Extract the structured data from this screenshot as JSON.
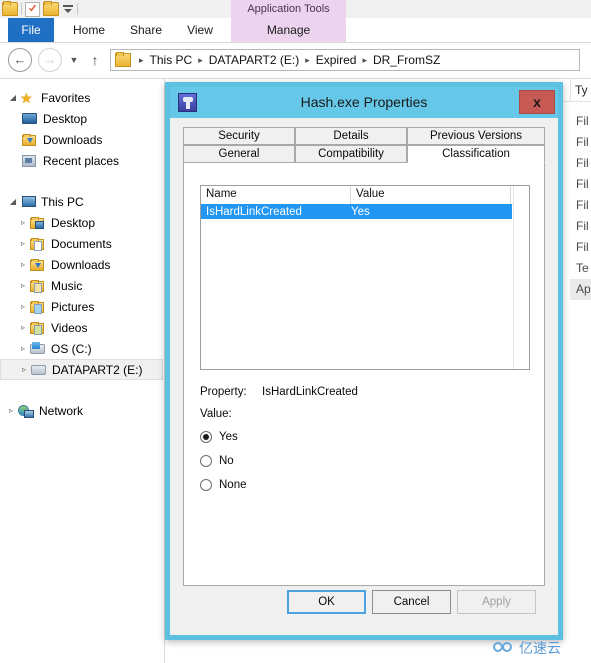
{
  "explorer": {
    "quick_access": {
      "icons": [
        "folder-icon",
        "properties-icon",
        "folder-icon",
        "customize-dropdown-icon"
      ]
    },
    "contextual_tab_group": "Application Tools",
    "ribbon_tabs": [
      {
        "label": "File",
        "active": true
      },
      {
        "label": "Home",
        "active": false
      },
      {
        "label": "Share",
        "active": false
      },
      {
        "label": "View",
        "active": false
      },
      {
        "label": "Manage",
        "active": false
      }
    ],
    "address_bar": {
      "back_glyph": "←",
      "forward_glyph": "→",
      "history_glyph": "▼",
      "up_glyph": "↑",
      "breadcrumbs": [
        "This PC",
        "DATAPART2 (E:)",
        "Expired",
        "DR_FromSZ"
      ],
      "separator": "▸"
    },
    "navigation_pane": {
      "groups": [
        {
          "header": {
            "label": "Favorites",
            "icon": "star-icon",
            "expander": "◢",
            "indent": 6
          },
          "items": [
            {
              "label": "Desktop",
              "icon": "monitor-icon",
              "expander": "",
              "indent": 22
            },
            {
              "label": "Downloads",
              "icon": "folder-download-icon",
              "expander": "",
              "indent": 22
            },
            {
              "label": "Recent places",
              "icon": "recent-places-icon",
              "expander": "",
              "indent": 22
            }
          ]
        },
        {
          "header": {
            "label": "This PC",
            "icon": "computer-icon",
            "expander": "◢",
            "indent": 6
          },
          "items": [
            {
              "label": "Desktop",
              "icon": "folder-desktop-icon",
              "expander": "▹",
              "indent": 16
            },
            {
              "label": "Documents",
              "icon": "folder-documents-icon",
              "expander": "▹",
              "indent": 16
            },
            {
              "label": "Downloads",
              "icon": "folder-download-icon",
              "expander": "▹",
              "indent": 16
            },
            {
              "label": "Music",
              "icon": "folder-music-icon",
              "expander": "▹",
              "indent": 16
            },
            {
              "label": "Pictures",
              "icon": "folder-pictures-icon",
              "expander": "▹",
              "indent": 16
            },
            {
              "label": "Videos",
              "icon": "folder-videos-icon",
              "expander": "▹",
              "indent": 16
            },
            {
              "label": "OS (C:)",
              "icon": "os-drive-icon",
              "expander": "▹",
              "indent": 16
            },
            {
              "label": "DATAPART2 (E:)",
              "icon": "drive-icon",
              "expander": "▹",
              "indent": 16,
              "selected": true
            }
          ]
        },
        {
          "header": {
            "label": "Network",
            "icon": "network-icon",
            "expander": "▹",
            "indent": 4
          },
          "items": []
        }
      ]
    },
    "file_list": {
      "type_column_header": "Ty",
      "type_rows": [
        "Fil",
        "Fil",
        "Fil",
        "Fil",
        "Fil",
        "Fil",
        "Fil",
        "Te",
        "Ap"
      ],
      "selected_row_index": 8
    }
  },
  "dialog": {
    "title": "Hash.exe Properties",
    "icon": "application-icon",
    "close_label": "x",
    "tab_rows": [
      [
        {
          "label": "Security",
          "active": false
        },
        {
          "label": "Details",
          "active": false
        },
        {
          "label": "Previous Versions",
          "active": false
        }
      ],
      [
        {
          "label": "General",
          "active": false
        },
        {
          "label": "Compatibility",
          "active": false
        },
        {
          "label": "Classification",
          "active": true
        }
      ]
    ],
    "classification": {
      "list_columns": [
        "Name",
        "Value"
      ],
      "rows": [
        {
          "name": "IsHardLinkCreated",
          "value": "Yes",
          "selected": true
        }
      ],
      "property_label": "Property:",
      "property_value": "IsHardLinkCreated",
      "value_label": "Value:",
      "options": [
        {
          "label": "Yes",
          "selected": true
        },
        {
          "label": "No",
          "selected": false
        },
        {
          "label": "None",
          "selected": false
        }
      ]
    },
    "buttons": [
      {
        "label": "OK",
        "state": "focused"
      },
      {
        "label": "Cancel",
        "state": "normal"
      },
      {
        "label": "Apply",
        "state": "disabled"
      }
    ]
  },
  "watermark": {
    "text": "亿速云"
  },
  "colors": {
    "ribbon_file_tab": "#1f6fc4",
    "contextual_tab": "#ecd4ef",
    "dialog_frame": "#5cc0e0",
    "dialog_titlebar": "#65c8e8",
    "close_button": "#c85a56",
    "list_selection": "#2196f3",
    "focus_border": "#4aa3dd"
  }
}
